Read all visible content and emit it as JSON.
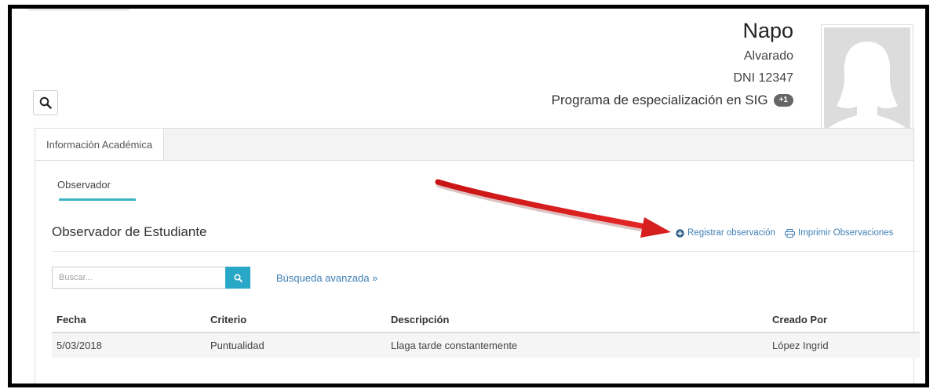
{
  "profile": {
    "first_name": "Napo",
    "last_name": "Alvarado",
    "dni": "DNI 12347",
    "program": "Programa de especialización en SIG",
    "program_badge": "+1"
  },
  "tabs": {
    "active": "Información Académica"
  },
  "subtabs": {
    "active": "Observador"
  },
  "section": {
    "title": "Observador de Estudiante",
    "register_label": "Registrar observación",
    "print_label": "Imprimir Observaciones"
  },
  "search": {
    "placeholder": "Buscar...",
    "advanced_label": "Búsqueda avanzada »"
  },
  "table": {
    "headers": [
      "Fecha",
      "Criterio",
      "Descripción",
      "Creado Por"
    ],
    "rows": [
      [
        "5/03/2018",
        "Puntualidad",
        "Llaga tarde constantemente",
        "López Ingrid"
      ]
    ]
  },
  "colors": {
    "accent": "#29a7c7",
    "link": "#3f7fb5",
    "arrow": "#d61f1f"
  },
  "icons": [
    "search-icon",
    "plus-circle-icon",
    "print-icon",
    "avatar-silhouette-icon",
    "chevrons-down-icon",
    "annotation-arrow"
  ]
}
